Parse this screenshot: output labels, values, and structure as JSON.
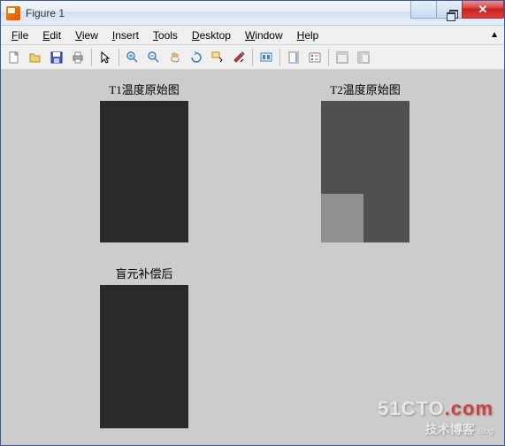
{
  "window": {
    "title": "Figure 1"
  },
  "menu": {
    "file": "File",
    "edit": "Edit",
    "view": "View",
    "insert": "Insert",
    "tools": "Tools",
    "desktop": "Desktop",
    "window": "Window",
    "help": "Help"
  },
  "subplots": {
    "t1": {
      "title": "T1温度原始图"
    },
    "t2": {
      "title": "T2温度原始图"
    },
    "comp": {
      "title": "盲元补偿后"
    }
  },
  "watermark": {
    "main1": "51CTO",
    "main2": ".com",
    "sub": "技术博客",
    "blog": "Blog"
  }
}
